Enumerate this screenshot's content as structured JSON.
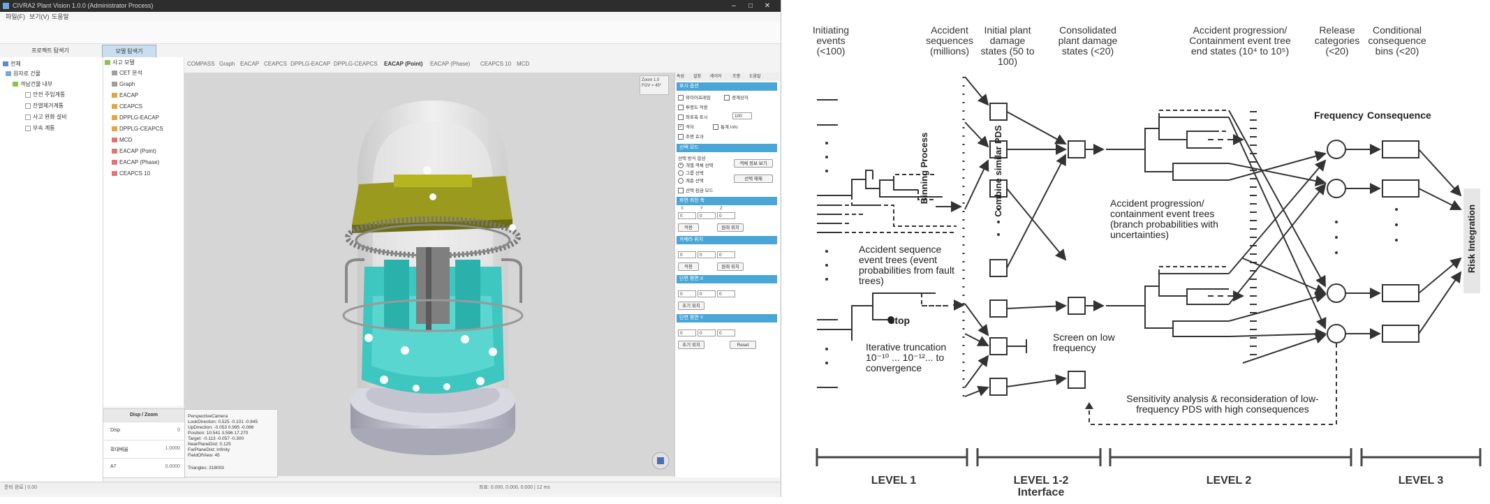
{
  "app": {
    "title": "CIVRA2 Plant Vision 1.0.0 (Administrator Process)",
    "window_buttons": [
      "–",
      "□",
      "✕"
    ],
    "menu": [
      "파일(F)",
      "보기(V)",
      "도움말"
    ],
    "left_tabs": [
      "프로젝트 탐색기",
      "모델 탐색기"
    ],
    "project_tree": [
      "전체",
      "원자로 건물",
      "격납건물 내부",
      "안전 주입계통",
      "잔열제거계통",
      "사고 완화 설비",
      "부속 계통"
    ],
    "model_tree": [
      "사고 모델",
      "CET 분석",
      "Graph",
      "EACAP",
      "CEAPCS",
      "DPPLG-EACAP",
      "DPPLG-CEAPCS",
      "MCD",
      "EACAP (Point)",
      "EACAP (Phase)",
      "CEAPCS 10"
    ],
    "view_tabs": [
      "COMPASS",
      "Graph",
      "EACAP",
      "CEAPCS",
      "DPPLG-EACAP",
      "DPPLG-CEAPCS",
      "EACAP (Point)",
      "EACAP (Phase)",
      "CEAPCS 10",
      "MCD"
    ],
    "view_corner": [
      "Zoom 1.0",
      "FOV = 45°"
    ],
    "disp": {
      "title": "Disp / Zoom",
      "rows": [
        {
          "key": "Disp",
          "value": "0"
        },
        {
          "key": "확대배율",
          "value": "1.0000"
        },
        {
          "key": "A7",
          "value": "0.0000"
        }
      ]
    },
    "info_lines": [
      "PerspectiveCamera",
      "LookDirection: 0.525 -0.101 -0.845",
      "UpDirection: -0.053 0.995 -0.086",
      "Position: 10.541 3.596 17.270",
      "Target: -0.113 -0.057 -0.300",
      "NearPlaneDist: 0.125",
      "FarPlaneDist: Infinity",
      "FieldOfView: 45",
      "Triangles: 318003"
    ],
    "status_left": "준비 완료 | 0.00",
    "status_mid": "좌표: 0.000, 0.000, 0.000 | 12 ms",
    "props": {
      "tabs": [
        "속성",
        "설정",
        "레이어",
        "조명",
        "도움말"
      ],
      "sections": [
        "표시 옵션",
        "선택 모드",
        "화면 회전 축",
        "카메라 위치",
        "단면 평면 X",
        "단면 평면 Y"
      ],
      "checks_left": [
        "와이어프레임",
        "투명도 적용",
        "좌표축 표시",
        "격자",
        "조명 효과"
      ],
      "checks_right": [
        "경계상자",
        "",
        "",
        "통계 Info",
        ""
      ],
      "opacity_value": "100",
      "radio": [
        "개별 객체 선택",
        "그룹 선택",
        "계층 선택"
      ],
      "radio_header": "선택 방식 옵션",
      "select_buttons": [
        "객체 정보 보기",
        "선택 해제"
      ],
      "lock_check": "선택 잠금 모드",
      "axis_labels": [
        "X",
        "Y",
        "Z"
      ],
      "vals": [
        "0",
        "0",
        "0"
      ],
      "btn_pairs": [
        [
          "적용",
          "원래 위치"
        ],
        [
          "적용",
          "원래 위치"
        ],
        [
          "초기 위치",
          ""
        ],
        [
          "초기 위치",
          "Reset"
        ]
      ]
    }
  },
  "diagram": {
    "headers": [
      "Initiating events (<100)",
      "Accident sequences (millions)",
      "Initial plant damage states (50 to 100)",
      "Consolidated plant damage states (<20)",
      "Accident progression/ Containment event tree end states (10⁴ to 10⁵)",
      "Release categories (<20)",
      "Conditional consequence bins (<20)"
    ],
    "labels": {
      "aset": "Accident sequence event trees (event probabilities from fault trees)",
      "stop": "Stop",
      "trunc": "Iterative truncation 10⁻¹⁰ ... 10⁻¹²... to convergence",
      "binning": "Binning Process",
      "combine": "Combine similar PDS",
      "screen": "Screen on low frequency",
      "apcet": "Accident progression/ containment event trees (branch probabilities with uncertainties)",
      "frequency": "Frequency",
      "consequence": "Consequence",
      "risk": "Risk Integration",
      "sens": "Sensitivity analysis & reconsideration of low-frequency PDS with high consequences"
    },
    "levels": [
      "LEVEL 1",
      "LEVEL 1-2 Interface",
      "LEVEL 2",
      "LEVEL 3"
    ]
  }
}
